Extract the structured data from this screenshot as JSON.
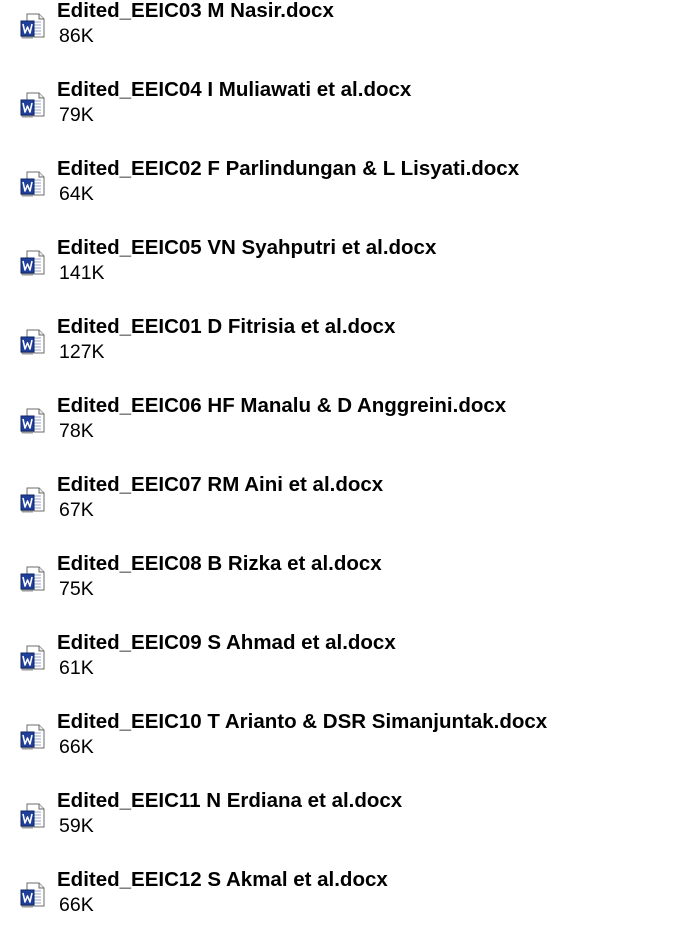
{
  "icon": "word-document-icon",
  "colors": {
    "icon_blue": "#1f3f9a",
    "icon_outline": "#6b6b6b"
  },
  "files": [
    {
      "name": "Edited_EEIC03 M Nasir.docx",
      "size": "86K"
    },
    {
      "name": "Edited_EEIC04 I Muliawati et al.docx",
      "size": "79K"
    },
    {
      "name": "Edited_EEIC02 F Parlindungan & L Lisyati.docx",
      "size": "64K"
    },
    {
      "name": "Edited_EEIC05 VN Syahputri et al.docx",
      "size": "141K"
    },
    {
      "name": "Edited_EEIC01 D Fitrisia et al.docx",
      "size": "127K"
    },
    {
      "name": "Edited_EEIC06 HF Manalu & D Anggreini.docx",
      "size": "78K"
    },
    {
      "name": "Edited_EEIC07 RM Aini et al.docx",
      "size": "67K"
    },
    {
      "name": "Edited_EEIC08 B Rizka et al.docx",
      "size": "75K"
    },
    {
      "name": "Edited_EEIC09 S Ahmad et al.docx",
      "size": "61K"
    },
    {
      "name": "Edited_EEIC10 T Arianto & DSR Simanjuntak.docx",
      "size": "66K"
    },
    {
      "name": "Edited_EEIC11 N Erdiana et al.docx",
      "size": "59K"
    },
    {
      "name": "Edited_EEIC12 S Akmal et al.docx",
      "size": "66K"
    }
  ]
}
